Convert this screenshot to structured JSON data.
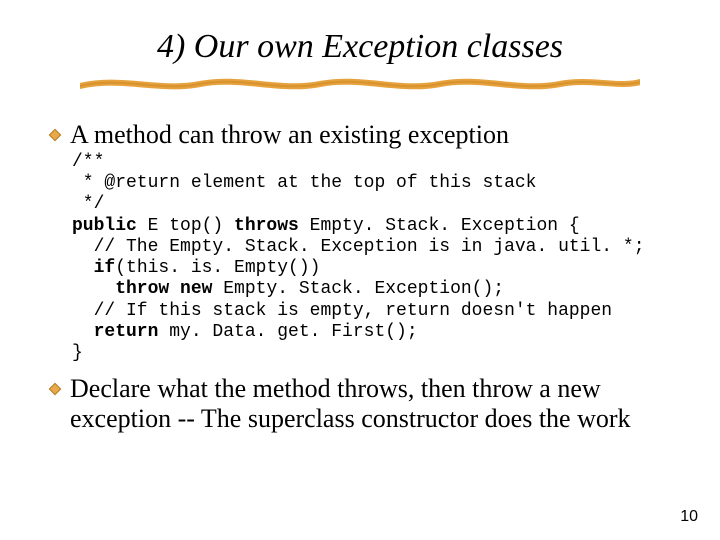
{
  "title": "4) Our own Exception classes",
  "bullet1": "A method can throw an existing exception",
  "bullet2": "Declare what the method throws, then throw a new exception -- The superclass constructor does the work",
  "code": {
    "l1": "/**",
    "l2": " * @return element at the top of this stack",
    "l3": " */",
    "l4a": "public",
    "l4b": " E top() ",
    "l4c": "throws",
    "l4d": " Empty. Stack. Exception {",
    "l5": "  // The Empty. Stack. Exception is in java. util. *;",
    "l6a": "  if",
    "l6b": "(this. is. Empty())",
    "l7a": "    throw new",
    "l7b": " Empty. Stack. Exception();",
    "l8": "  // If this stack is empty, return doesn't happen",
    "l9a": "  return",
    "l9b": " my. Data. get. First();",
    "l10": "}"
  },
  "page_number": "10",
  "colors": {
    "accent_orange": "#e6a23c",
    "accent_brown": "#d28b2a",
    "diamond_fill": "#e6a84a",
    "diamond_stroke": "#b5781f"
  }
}
